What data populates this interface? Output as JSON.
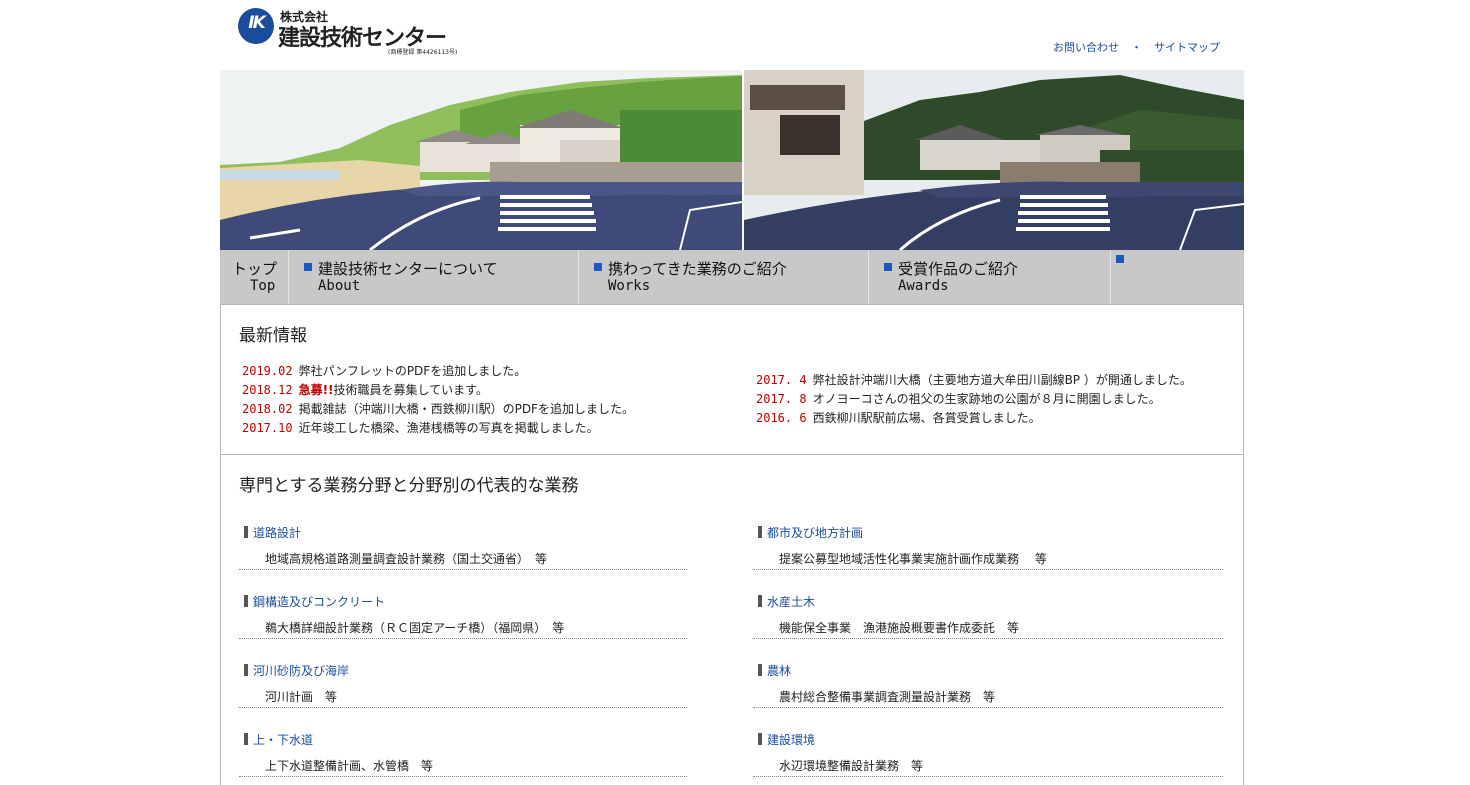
{
  "header": {
    "logo_mark": "IK",
    "company_prefix": "株式会社",
    "company_name": "建設技術センター",
    "registration": "(商標登録 第4426113号)",
    "links": [
      "お問い合わせ",
      "サイトマップ"
    ],
    "link_separator": "・"
  },
  "nav": {
    "items": [
      {
        "jp": "トップ",
        "en": "Top"
      },
      {
        "jp": "建設技術センターについて",
        "en": "About"
      },
      {
        "jp": "携わってきた業務のご紹介",
        "en": "Works"
      },
      {
        "jp": "受賞作品のご紹介",
        "en": "Awards"
      }
    ],
    "accent_color": "#1b5bbd"
  },
  "news": {
    "title": "最新情報",
    "left": [
      {
        "date": "2019.02",
        "text": "弊社パンフレットのPDFを追加しました。"
      },
      {
        "date": "2018.12",
        "urgent": "急募!!",
        "text": "技術職員を募集しています。"
      },
      {
        "date": "2018.02",
        "text": "掲載雑誌（沖端川大橋・西鉄柳川駅）のPDFを追加しました。"
      },
      {
        "date": "2017.10",
        "text": "近年竣工した橋梁、漁港桟橋等の写真を掲載しました。"
      }
    ],
    "right": [
      {
        "date": "2017. 4",
        "text": "弊社設計沖端川大橋（主要地方道大牟田川副線BP ）が開通しました。"
      },
      {
        "date": "2017. 8",
        "text": "オノヨーコさんの祖父の生家跡地の公園が８月に開園しました。"
      },
      {
        "date": "2016. 6",
        "text": "西鉄柳川駅駅前広場、各賞受賞しました。"
      }
    ]
  },
  "fields": {
    "title": "専門とする業務分野と分野別の代表的な業務",
    "left": [
      {
        "name": "道路設計",
        "work": "地域高規格道路測量調査設計業務（国土交通省）　等"
      },
      {
        "name": "鋼構造及びコンクリート",
        "work": "鵜大橋詳細設計業務（ＲＣ固定アーチ橋）（福岡県）　等"
      },
      {
        "name": "河川砂防及び海岸",
        "work": "河川計画　等"
      },
      {
        "name": "上・下水道",
        "work": "上下水道整備計画、水管橋　等"
      }
    ],
    "right": [
      {
        "name": "都市及び地方計画",
        "work": "提案公募型地域活性化事業実施計画作成業務　 等"
      },
      {
        "name": "水産土木",
        "work": "機能保全事業　漁港施設概要書作成委託　等"
      },
      {
        "name": "農林",
        "work": "農村総合整備事業調査測量設計業務　等"
      },
      {
        "name": "建設環境",
        "work": "水辺環境整備設計業務　等"
      }
    ]
  },
  "colors": {
    "brand": "#1b4c9c",
    "news_date": "#c00000",
    "nav_bg": "#c8c8c8"
  }
}
